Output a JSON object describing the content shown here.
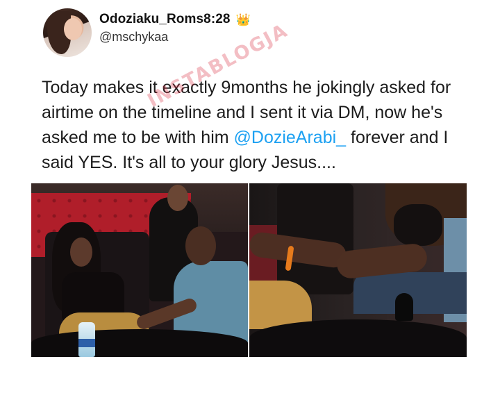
{
  "tweet": {
    "display_name": "Odoziaku_Roms8:28",
    "handle": "@mschykaа",
    "crown_icon": "crown-icon",
    "text_before": "Today makes it exactly 9months he jokingly asked for airtime on the timeline and I sent it via DM, now he's asked me to be with him ",
    "mention": "@DozieArabi_",
    "text_after": " forever and I said YES. It's all to your glory Jesus....",
    "watermark": "INSTABLOGJA"
  },
  "colors": {
    "mention": "#1da1f2",
    "text": "#1c1c1c",
    "background": "#ffffff"
  }
}
